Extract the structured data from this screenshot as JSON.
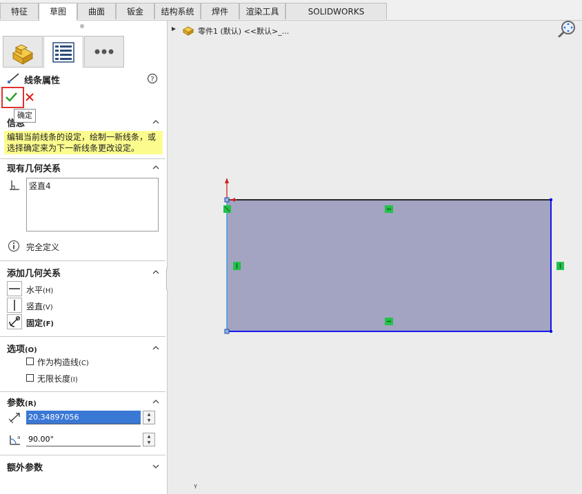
{
  "tabs": [
    {
      "label": "特征",
      "active": false
    },
    {
      "label": "草图",
      "active": true
    },
    {
      "label": "曲面",
      "active": false
    },
    {
      "label": "钣金",
      "active": false
    },
    {
      "label": "结构系统",
      "active": false
    },
    {
      "label": "焊件",
      "active": false
    },
    {
      "label": "渲染工具",
      "active": false
    },
    {
      "label": "SOLIDWORKS Inspection",
      "active": false
    }
  ],
  "manager_tabs": [
    "feature-manager",
    "property-manager",
    "more"
  ],
  "panel": {
    "title": "线条属性",
    "ok_tooltip": "确定",
    "message_header": "信息",
    "message_text": "编辑当前线条的设定，绘制一新线条，或选择确定来为下一新线条更改设定。",
    "existing_relations_header": "现有几何关系",
    "existing_relations": [
      "竖直4"
    ],
    "status": "完全定义",
    "add_relations_header": "添加几何关系",
    "add_relations": [
      {
        "label": "水平",
        "key": "(H)"
      },
      {
        "label": "竖直",
        "key": "(V)"
      },
      {
        "label": "固定",
        "key": "(F)"
      }
    ],
    "options_header": "选项",
    "options_key": "(O)",
    "options": [
      {
        "label": "作为构造线",
        "key": "(C)",
        "checked": false
      },
      {
        "label": "无限长度",
        "key": "(I)",
        "checked": false
      }
    ],
    "params_header": "参数",
    "params_key": "(R)",
    "length_value": "20.34897056",
    "angle_value": "90.00°",
    "extra_params_header": "额外参数"
  },
  "tree": {
    "label": "零件1 (默认) <<默认>_..."
  },
  "colors": {
    "rect_fill": "#a3a3c2",
    "rect_edge": "#0000ee",
    "relation_marker": "#22c24a",
    "accept": "#2aa02a",
    "cancel": "#e02020",
    "highlight": "#e03030"
  },
  "axis_label": "Y"
}
